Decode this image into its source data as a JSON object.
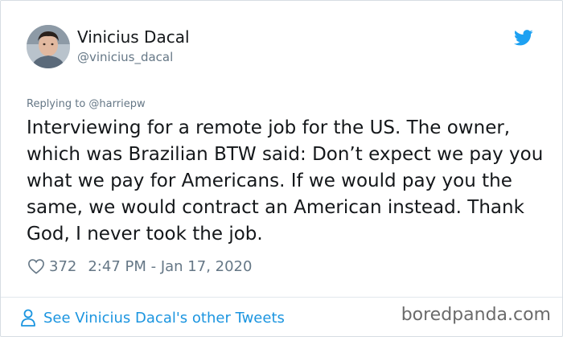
{
  "tweet": {
    "author_name": "Vinicius Dacal",
    "author_handle": "@vinicius_dacal",
    "replying_to": "Replying to @harriepw",
    "text": "Interviewing for a remote job for the US. The owner, which was Brazilian BTW said: Don’t expect we pay you what we pay for Americans. If we would pay you the same, we would contract an American instead. Thank God, I never took the job.",
    "likes": "372",
    "timestamp": "2:47 PM - Jan 17, 2020"
  },
  "footer": {
    "other_tweets_link": "See Vinicius Dacal's other Tweets"
  },
  "watermark": "boredpanda.com",
  "colors": {
    "accent": "#1b95e0",
    "twitter_blue": "#1da1f2",
    "secondary_text": "#657786",
    "primary_text": "#14171a"
  },
  "icons": {
    "brand": "twitter-bird-icon",
    "like": "heart-icon",
    "profile": "person-icon"
  }
}
